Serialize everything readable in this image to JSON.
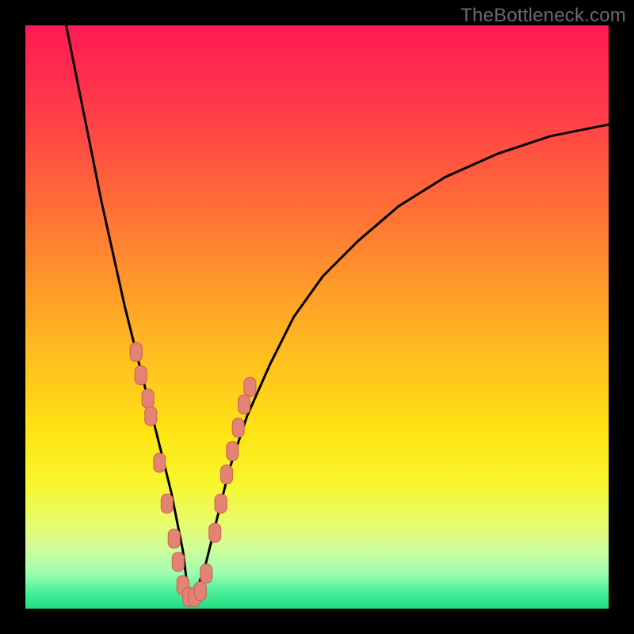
{
  "watermark": "TheBottleneck.com",
  "colors": {
    "frame": "#000000",
    "gradient_stops": [
      {
        "pct": 0,
        "color": "#ff1a54"
      },
      {
        "pct": 14,
        "color": "#ff3a4a"
      },
      {
        "pct": 30,
        "color": "#ff6a38"
      },
      {
        "pct": 45,
        "color": "#ff9a2a"
      },
      {
        "pct": 58,
        "color": "#ffc21e"
      },
      {
        "pct": 70,
        "color": "#ffe414"
      },
      {
        "pct": 78,
        "color": "#f8f62a"
      },
      {
        "pct": 85,
        "color": "#e9fb6a"
      },
      {
        "pct": 90,
        "color": "#cdfd9a"
      },
      {
        "pct": 94,
        "color": "#9dfdb0"
      },
      {
        "pct": 97,
        "color": "#4ef09a"
      },
      {
        "pct": 100,
        "color": "#1fdc82"
      }
    ],
    "curve": "#000000",
    "marker_fill": "#e48273",
    "marker_stroke": "#c95f53"
  },
  "chart_data": {
    "type": "line",
    "title": "",
    "xlabel": "",
    "ylabel": "",
    "xlim": [
      0,
      100
    ],
    "ylim": [
      0,
      100
    ],
    "note": "V-shaped bottleneck curve. Values estimated from pixel positions on a 0–100 grid; vertex near x≈28, y≈0. y=100 is top of plot.",
    "series": [
      {
        "name": "bottleneck-curve",
        "x": [
          7,
          9,
          11,
          13,
          15,
          17,
          19,
          21,
          23,
          25,
          27,
          28,
          29,
          31,
          33,
          35,
          38,
          42,
          46,
          51,
          57,
          64,
          72,
          81,
          90,
          100
        ],
        "y": [
          100,
          90,
          80,
          70,
          61,
          52,
          44,
          36,
          28,
          20,
          10,
          2,
          2,
          8,
          16,
          24,
          33,
          42,
          50,
          57,
          63,
          69,
          74,
          78,
          81,
          83
        ]
      }
    ],
    "markers": {
      "name": "highlighted-points",
      "note": "Salmon rounded markers clustered along both legs near the vertex.",
      "points": [
        {
          "x": 19.0,
          "y": 44
        },
        {
          "x": 19.8,
          "y": 40
        },
        {
          "x": 21.0,
          "y": 36
        },
        {
          "x": 21.5,
          "y": 33
        },
        {
          "x": 23.0,
          "y": 25
        },
        {
          "x": 24.3,
          "y": 18
        },
        {
          "x": 25.5,
          "y": 12
        },
        {
          "x": 26.2,
          "y": 8
        },
        {
          "x": 27.0,
          "y": 4
        },
        {
          "x": 28.0,
          "y": 2
        },
        {
          "x": 29.0,
          "y": 2
        },
        {
          "x": 30.0,
          "y": 3
        },
        {
          "x": 31.0,
          "y": 6
        },
        {
          "x": 32.5,
          "y": 13
        },
        {
          "x": 33.5,
          "y": 18
        },
        {
          "x": 34.5,
          "y": 23
        },
        {
          "x": 35.5,
          "y": 27
        },
        {
          "x": 36.5,
          "y": 31
        },
        {
          "x": 37.5,
          "y": 35
        },
        {
          "x": 38.5,
          "y": 38
        }
      ]
    }
  }
}
